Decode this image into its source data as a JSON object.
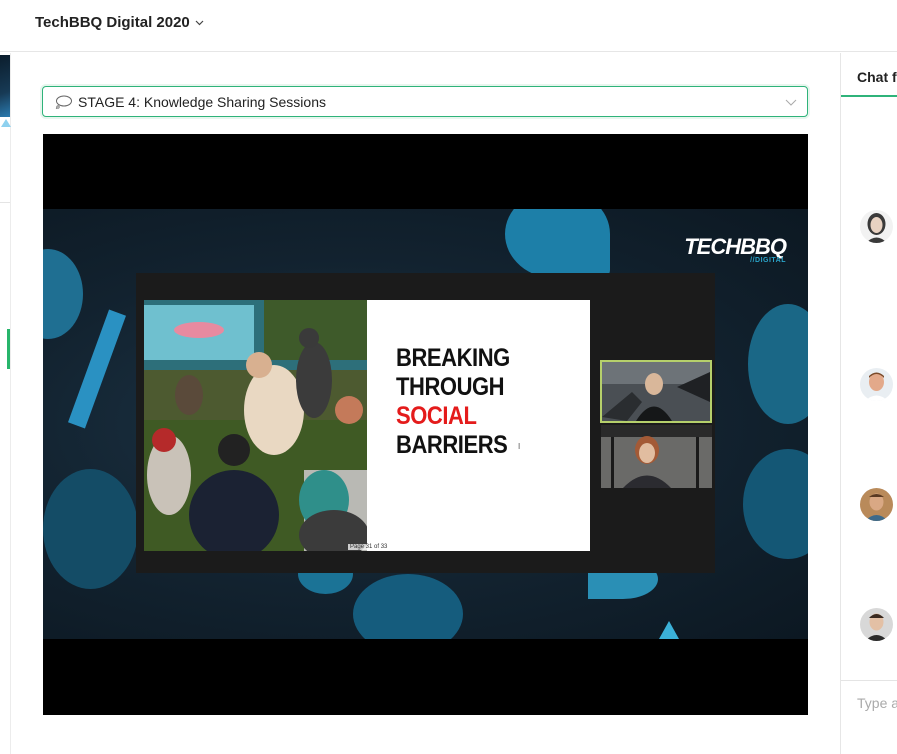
{
  "header": {
    "event_title": "TechBBQ Digital 2020",
    "chevron_icon": "chevron-down-icon"
  },
  "stage_select": {
    "icon": "speech-bubble-icon",
    "selected": "STAGE 4: Knowledge Sharing Sessions",
    "chevron_icon": "chevron-down-icon"
  },
  "player": {
    "logo": {
      "main": "TECHBBQ",
      "sub": "//DIGITAL"
    },
    "slide": {
      "line1": "BREAKING",
      "line2": "THROUGH",
      "line3": "SOCIAL",
      "line4": "BARRIERS",
      "page_indicator": "Page 31 of 33",
      "cursor": "I"
    },
    "accent_red": "#e41b1b",
    "participants_shown": 2
  },
  "chat": {
    "tab_label": "Chat fo",
    "input_placeholder": "Type a",
    "avatars": 4,
    "accent": "#2fb37a"
  }
}
